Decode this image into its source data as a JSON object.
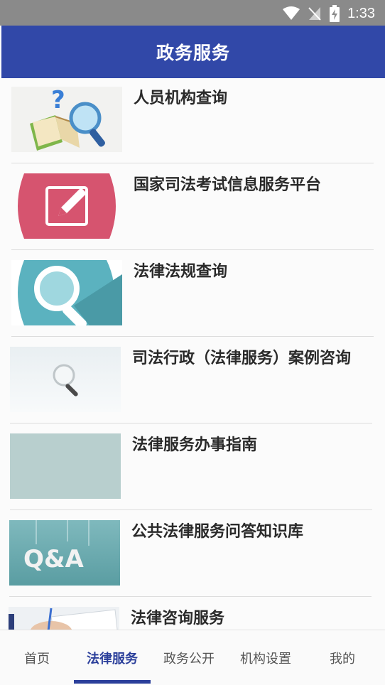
{
  "status_bar": {
    "time": "1:33",
    "icons": [
      "wifi-icon",
      "no-signal-icon",
      "battery-charging-icon"
    ]
  },
  "header": {
    "title": "政务服务"
  },
  "list": {
    "items": [
      {
        "label": "人员机构查询",
        "icon": "book-magnifier-question-icon"
      },
      {
        "label": "国家司法考试信息服务平台",
        "icon": "edit-pencil-icon"
      },
      {
        "label": "法律法规查询",
        "icon": "magnifier-icon"
      },
      {
        "label": "司法行政（法律服务）案例咨询",
        "icon": "magnifier-icon"
      },
      {
        "label": "法律服务办事指南",
        "icon": "image-placeholder"
      },
      {
        "label": "公共法律服务问答知识库",
        "icon": "qa-icon",
        "image_text": "Q&A"
      },
      {
        "label": "法律咨询服务",
        "icon": "writing-hand-icon"
      }
    ]
  },
  "tabs": [
    {
      "label": "首页"
    },
    {
      "label": "法律服务",
      "active": true
    },
    {
      "label": "政务公开"
    },
    {
      "label": "机构设置"
    },
    {
      "label": "我的"
    }
  ]
}
